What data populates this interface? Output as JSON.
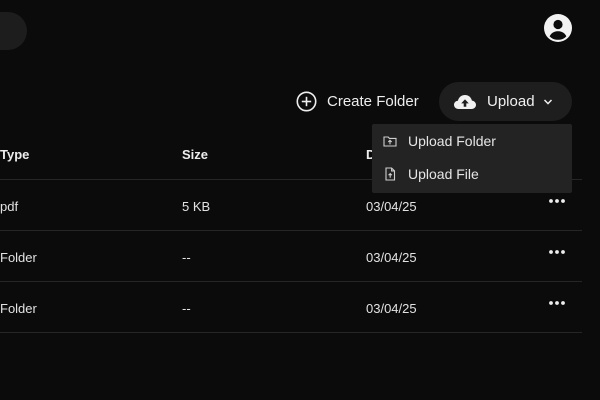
{
  "toolbar": {
    "create_folder_label": "Create Folder",
    "upload_label": "Upload",
    "account_icon": "account-circle-icon"
  },
  "upload_menu": {
    "items": [
      {
        "label": "Upload Folder",
        "icon": "folder-upload-icon"
      },
      {
        "label": "Upload File",
        "icon": "file-upload-icon"
      }
    ]
  },
  "table": {
    "headers": {
      "type": "Type",
      "size": "Size",
      "date": "D"
    },
    "rows": [
      {
        "type": "pdf",
        "size": "5 KB",
        "date": "03/04/25"
      },
      {
        "type": "Folder",
        "size": "--",
        "date": "03/04/25"
      },
      {
        "type": "Folder",
        "size": "--",
        "date": "03/04/25"
      }
    ]
  },
  "colors": {
    "background": "#0b0b0b",
    "button_bg": "#1e1e1e",
    "menu_bg": "#232323",
    "text": "#e8e8e8",
    "divider": "#262626"
  }
}
